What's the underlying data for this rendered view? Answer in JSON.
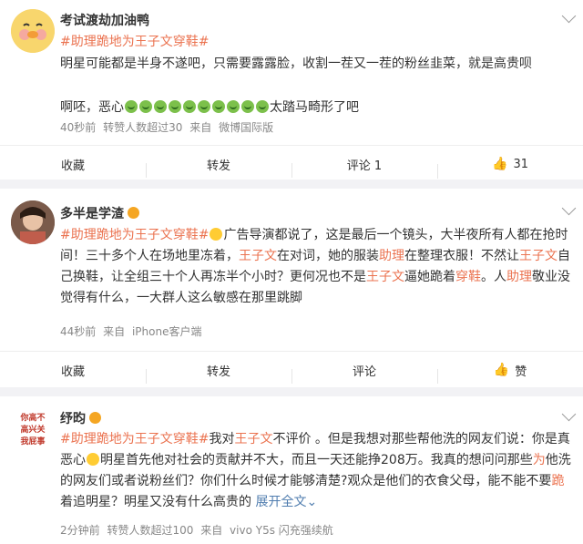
{
  "posts": [
    {
      "user": "考试渡劫加油鸭",
      "segments": [
        {
          "t": "#助理跪地为王子文穿鞋#",
          "c": "tag"
        },
        {
          "t": "明星可能都是半身不遂吧，只需要露露脸，收割一茬又一茬的粉丝韭菜，就是高贵呗",
          "c": "txt"
        },
        {
          "t": "\n\n啊呸，恶心",
          "c": "txt"
        },
        {
          "t": "🤮🤮🤮🤮🤮🤮🤮🤮🤮🤮",
          "c": "emoji"
        },
        {
          "t": "太踏马畸形了吧",
          "c": "txt"
        }
      ],
      "meta": [
        "40秒前",
        "转赞人数超过30",
        "来自",
        "微博国际版"
      ],
      "actions": {
        "collect": "收藏",
        "repost": "转发",
        "comment": "评论 1",
        "like": "31"
      }
    },
    {
      "user": "多半是学渣",
      "segments": [
        {
          "t": "#助理跪地为王子文穿鞋#",
          "c": "tag"
        },
        {
          "t": "😅",
          "c": "emoji-y"
        },
        {
          "t": "广告导演都说了，这是最后一个镜头，大半夜所有人都在抢时间！三十多个人在场地里冻着，",
          "c": "txt"
        },
        {
          "t": "王子文",
          "c": "hl"
        },
        {
          "t": "在对词，她的服装",
          "c": "txt"
        },
        {
          "t": "助理",
          "c": "hl"
        },
        {
          "t": "在整理衣服！不然让",
          "c": "txt"
        },
        {
          "t": "王子文",
          "c": "hl"
        },
        {
          "t": "自己换鞋，让全组三十个人再冻半个小时？更何况也不是",
          "c": "txt"
        },
        {
          "t": "王子文",
          "c": "hl"
        },
        {
          "t": "逼她跪着",
          "c": "txt"
        },
        {
          "t": "穿鞋",
          "c": "hl"
        },
        {
          "t": "。人",
          "c": "txt"
        },
        {
          "t": "助理",
          "c": "hl"
        },
        {
          "t": "敬业没觉得有什么，一大群人这么敏感在那里跳脚",
          "c": "txt"
        }
      ],
      "meta": [
        "44秒前",
        "来自",
        "iPhone客户端"
      ],
      "actions": {
        "collect": "收藏",
        "repost": "转发",
        "comment": "评论",
        "like": "赞"
      }
    },
    {
      "user": "纾昀",
      "avatar_text": "你高不\n高兴关\n我屁事",
      "segments": [
        {
          "t": "#助理跪地为王子文穿鞋#",
          "c": "tag"
        },
        {
          "t": "我对",
          "c": "txt"
        },
        {
          "t": "王子文",
          "c": "hl"
        },
        {
          "t": "不评价 。但是我想对那些帮他洗的网友们说：你是真恶心",
          "c": "txt"
        },
        {
          "t": "😫",
          "c": "emoji-y"
        },
        {
          "t": "明星首先他对社会的贡献并不大，而且一天还能挣208万。我真的想问问那些",
          "c": "txt"
        },
        {
          "t": "为",
          "c": "hl"
        },
        {
          "t": "他洗的网友们或者说粉丝们？你们什么时候才能够清楚?观众是他们的衣食父母，能不能不要",
          "c": "txt"
        },
        {
          "t": "跪",
          "c": "hl"
        },
        {
          "t": "着追明星？明星又没有什么高贵的 ",
          "c": "txt"
        },
        {
          "t": "展开全文",
          "c": "more"
        },
        {
          "t": "⌄",
          "c": "more"
        }
      ],
      "meta": [
        "2分钟前",
        "转赞人数超过100",
        "来自",
        "vivo Y5s 闪充强续航"
      ],
      "actions": {}
    }
  ],
  "icons": {
    "repost": "repost-icon",
    "comment": "comment-icon",
    "like": "thumbs-up-icon",
    "more": "chevron-down-icon"
  },
  "colors": {
    "tag": "#eb7350",
    "link": "#507daf",
    "meta": "#888888"
  }
}
